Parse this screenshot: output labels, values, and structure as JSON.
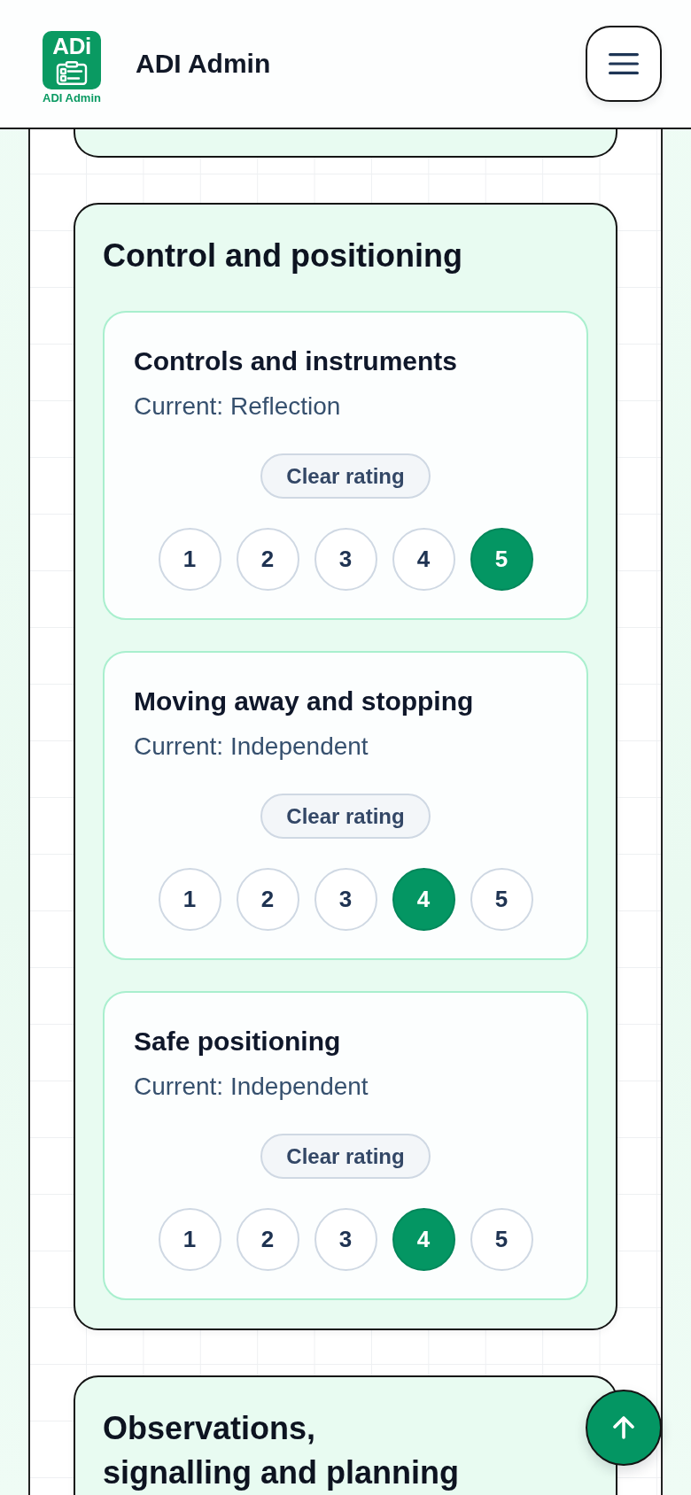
{
  "header": {
    "logo": {
      "lettering": "ADi",
      "caption": "ADI Admin"
    },
    "title": "ADI Admin"
  },
  "sections": [
    {
      "kind": "tail"
    },
    {
      "kind": "full",
      "title": "Control and positioning",
      "skills": [
        {
          "name": "Controls and instruments",
          "current": "Current: Reflection",
          "clear_label": "Clear rating",
          "ratings": [
            {
              "label": "1",
              "selected": false
            },
            {
              "label": "2",
              "selected": false
            },
            {
              "label": "3",
              "selected": false
            },
            {
              "label": "4",
              "selected": false
            },
            {
              "label": "5",
              "selected": true
            }
          ]
        },
        {
          "name": "Moving away and stopping",
          "current": "Current: Independent",
          "clear_label": "Clear rating",
          "ratings": [
            {
              "label": "1",
              "selected": false
            },
            {
              "label": "2",
              "selected": false
            },
            {
              "label": "3",
              "selected": false
            },
            {
              "label": "4",
              "selected": true
            },
            {
              "label": "5",
              "selected": false
            }
          ]
        },
        {
          "name": "Safe positioning",
          "current": "Current: Independent",
          "clear_label": "Clear rating",
          "ratings": [
            {
              "label": "1",
              "selected": false
            },
            {
              "label": "2",
              "selected": false
            },
            {
              "label": "3",
              "selected": false
            },
            {
              "label": "4",
              "selected": true
            },
            {
              "label": "5",
              "selected": false
            }
          ]
        }
      ]
    },
    {
      "kind": "full",
      "title": "Observations, signalling and planning"
    }
  ]
}
